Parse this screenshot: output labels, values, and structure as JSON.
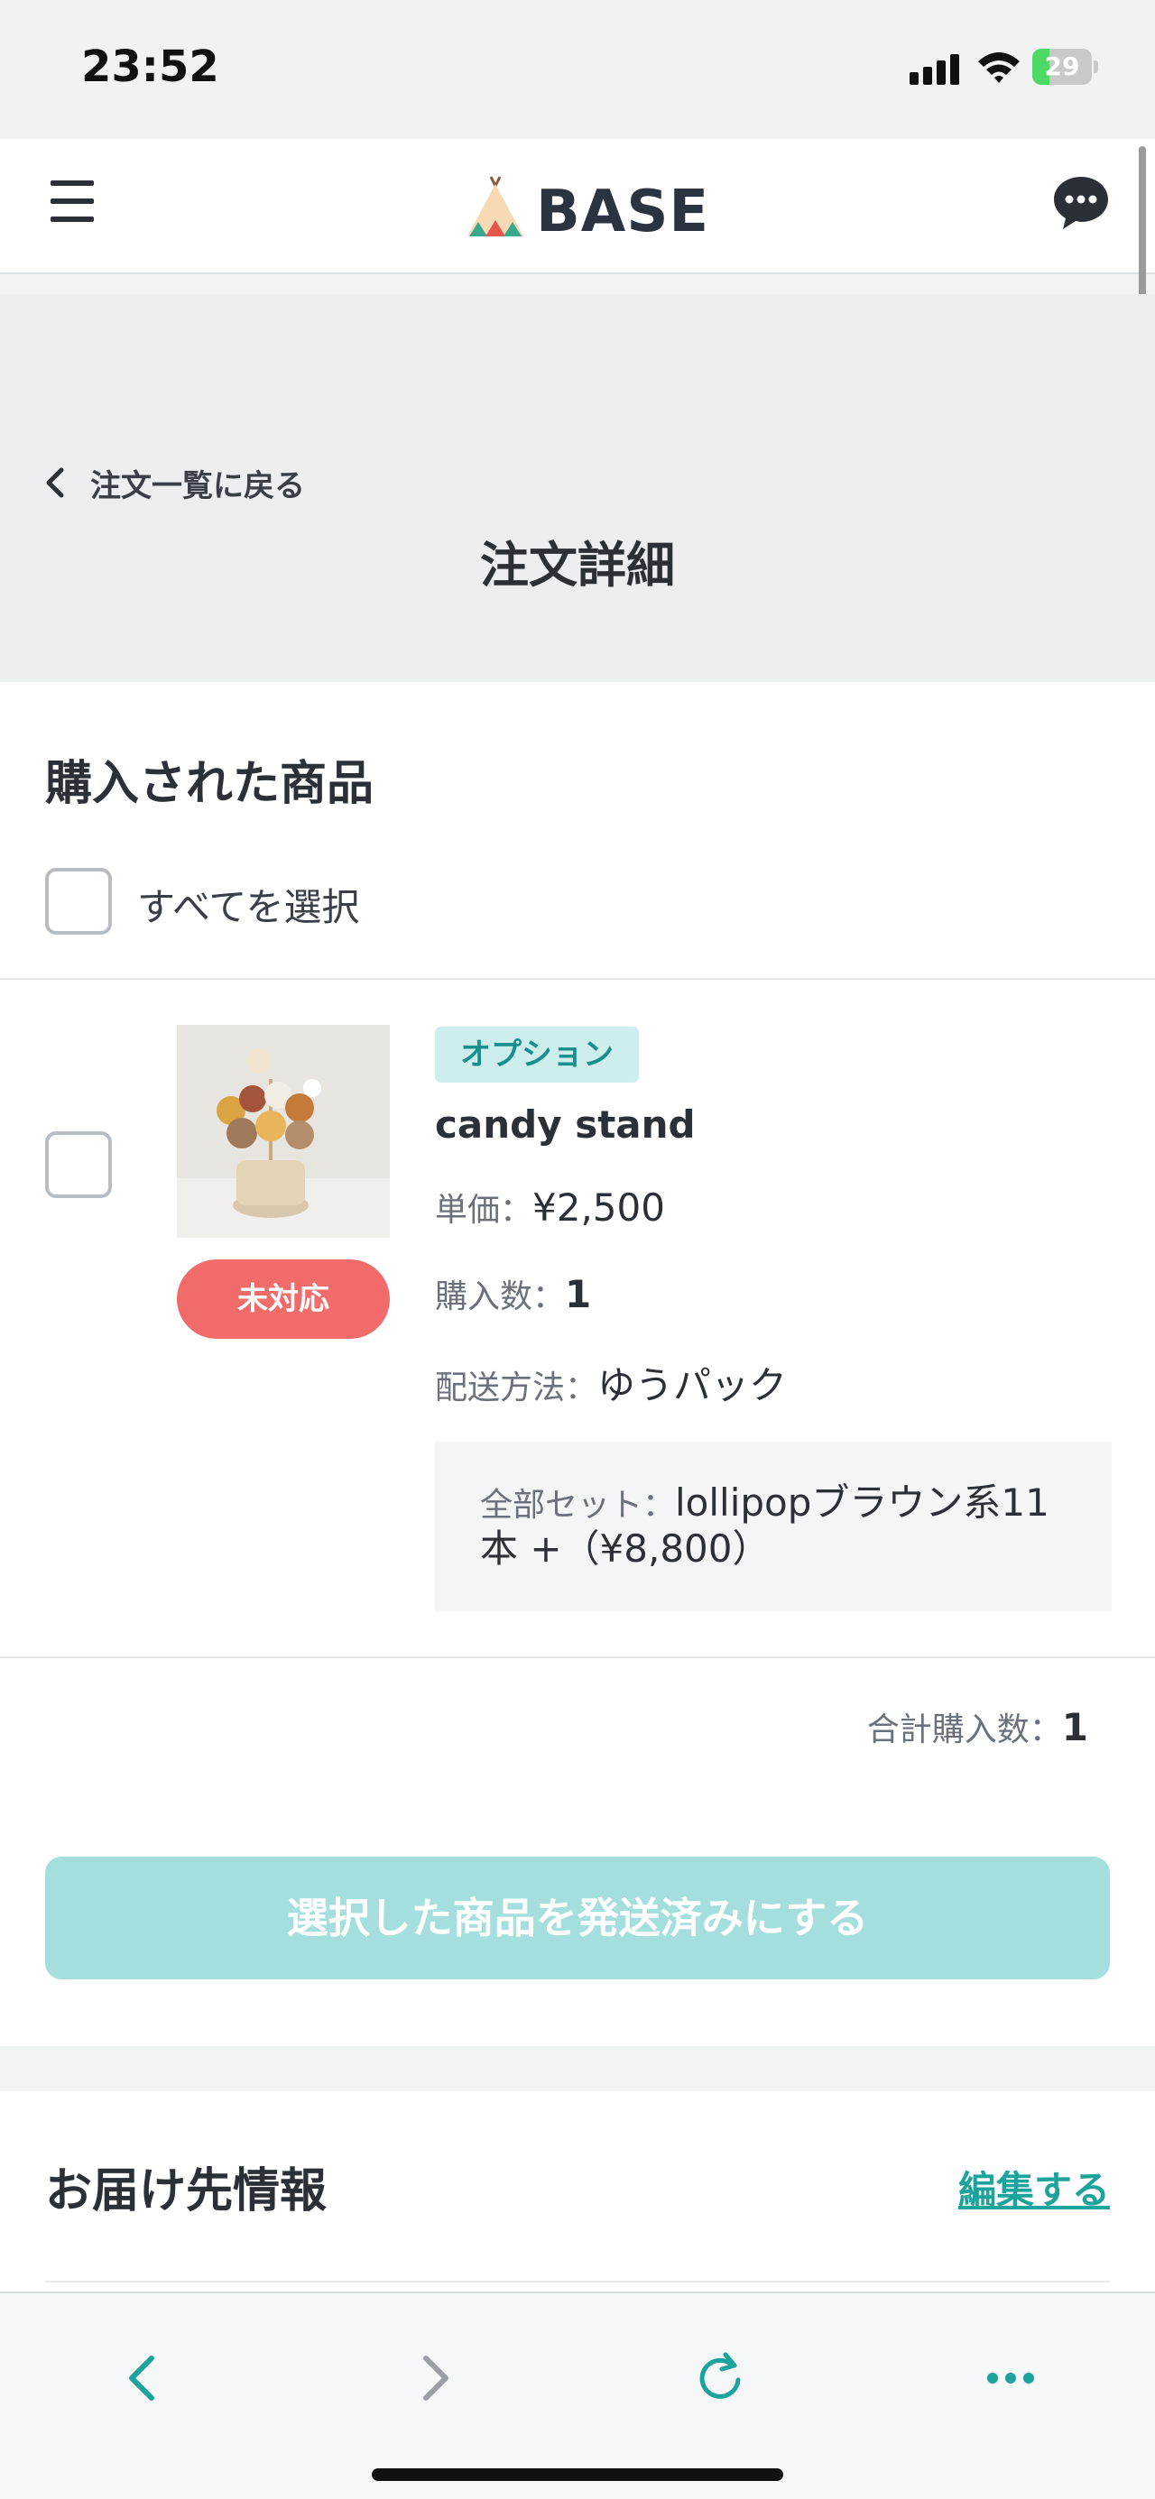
{
  "status_bar": {
    "time": "23:52",
    "battery_level": "29",
    "battery_percent": 29
  },
  "header": {
    "logo_text": "BASE",
    "brand_color": "#1ba39c"
  },
  "title_band": {
    "back_label": "注文一覧に戻る",
    "page_title": "注文詳細"
  },
  "products": {
    "section_title": "購入された商品",
    "select_all_label": "すべてを選択",
    "items": [
      {
        "option_tag": "オプション",
        "name": "candy stand",
        "status": "未対応",
        "unit_price_label": "単価：",
        "unit_price": "¥2,500",
        "quantity_label": "購入数：",
        "quantity": "1",
        "shipping_label": "配送方法：",
        "shipping_method": "ゆうパック",
        "option_label": "全部セット：",
        "option_value_line1": "lollipopブラウン系11",
        "option_value_line2": "本 +（¥8,800）"
      }
    ],
    "total_label": "合計購入数：",
    "total_value": "1",
    "ship_button_label": "選択した商品を発送済みにする",
    "status_color": "#f26b6b"
  },
  "delivery": {
    "title": "お届け先情報",
    "edit_label": "編集する"
  },
  "browser_bar": {
    "icons": [
      "back-icon",
      "forward-icon",
      "reload-icon",
      "more-icon"
    ]
  }
}
